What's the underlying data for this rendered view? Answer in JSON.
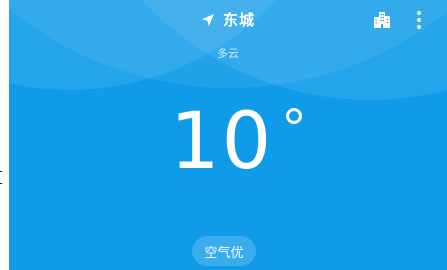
{
  "header": {
    "city": "东城",
    "location_icon": "navigation-arrow-icon",
    "city_list_icon": "buildings-icon",
    "menu_icon": "more-vert-icon"
  },
  "weather": {
    "condition": "多云",
    "temperature": "10"
  },
  "air_quality": {
    "label": "空气优"
  },
  "colors": {
    "background": "#0f9be8",
    "text": "#ffffff"
  }
}
